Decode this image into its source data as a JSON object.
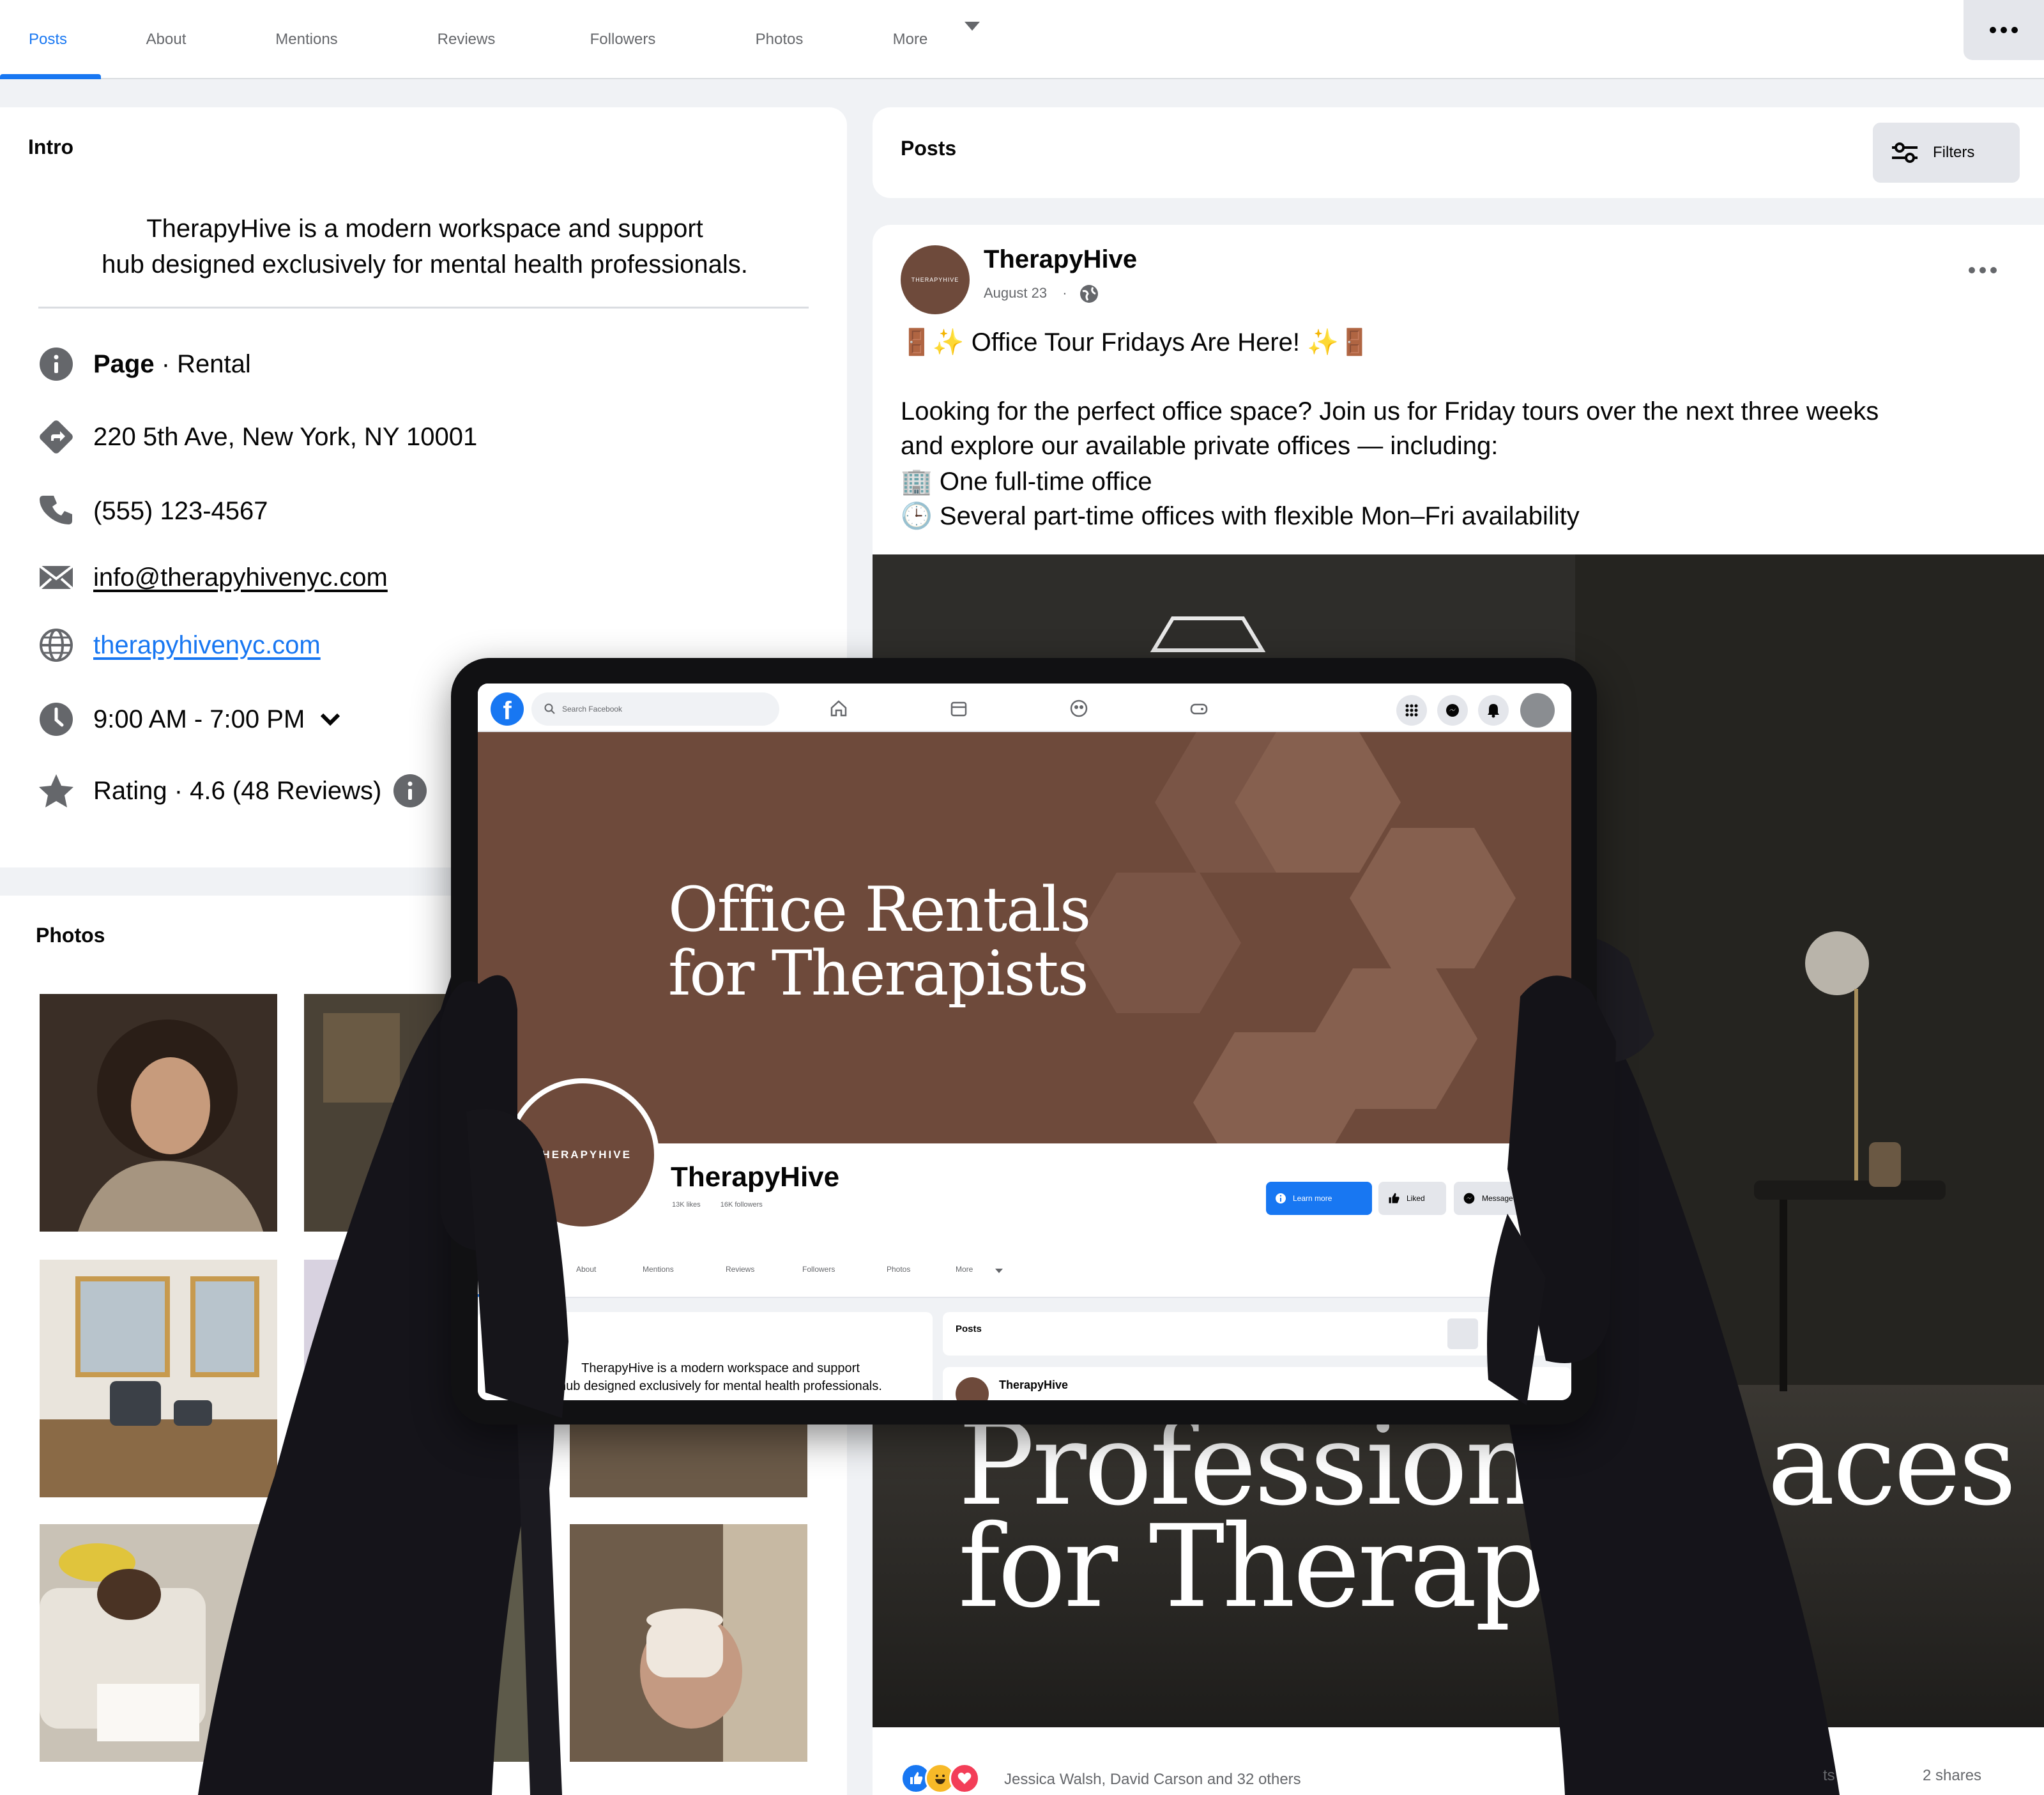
{
  "tabs": [
    {
      "label": "Posts",
      "active": true
    },
    {
      "label": "About"
    },
    {
      "label": "Mentions"
    },
    {
      "label": "Reviews"
    },
    {
      "label": "Followers"
    },
    {
      "label": "Photos"
    },
    {
      "label": "More"
    }
  ],
  "intro": {
    "title": "Intro",
    "bio_line1": "TherapyHive is a modern workspace and support",
    "bio_line2": "hub designed exclusively for mental health professionals.",
    "category_bold": "Page",
    "category_rest": " · Rental",
    "address": "220 5th Ave, New York, NY 10001",
    "phone": "(555) 123-4567",
    "email": "info@therapyhivenyc.com",
    "website": "therapyhivenyc.com",
    "hours": "9:00 AM - 7:00 PM",
    "rating": "Rating · 4.6 (48 Reviews)"
  },
  "photos": {
    "title": "Photos"
  },
  "posts_header": {
    "title": "Posts",
    "filters_label": "Filters"
  },
  "post": {
    "author": "TherapyHive",
    "date": "August 23",
    "dot": "·",
    "headline": "🚪✨ Office Tour Fridays Are Here! ✨🚪",
    "body_line1": "Looking for the perfect office space? Join us for Friday tours over the next three weeks",
    "body_line2": "and explore our available private offices — including:",
    "bullet1": "🏢 One full-time office",
    "bullet2": "🕒 Several part-time offices with flexible Mon–Fri availability",
    "image_text_line1": "Professiona",
    "image_text_line1b": "aces",
    "image_text_line2": "for Therapis",
    "reactions_names": "Jessica Walsh, David Carson and 32 others",
    "comments_partial": "ts",
    "shares": "2 shares"
  },
  "tablet": {
    "search_placeholder": "Search Facebook",
    "cover_title_line1": "Office Rentals",
    "cover_title_line2": "for Therapists",
    "logo_text": "THERAPYHIVE",
    "page_name": "TherapyHive",
    "likes": "13K likes",
    "followers": "16K followers",
    "btn_learn": "Learn more",
    "btn_liked": "Liked",
    "btn_message": "Message",
    "tabs": [
      "About",
      "Mentions",
      "Reviews",
      "Followers",
      "Photos",
      "More"
    ],
    "intro_line1": "TherapyHive is a modern workspace and support",
    "intro_line2": "hub designed exclusively for mental health professionals.",
    "posts_label": "Posts",
    "post_author": "TherapyHive"
  },
  "colors": {
    "brand_blue": "#1877f2",
    "brand_brown": "#6e4a3b"
  }
}
